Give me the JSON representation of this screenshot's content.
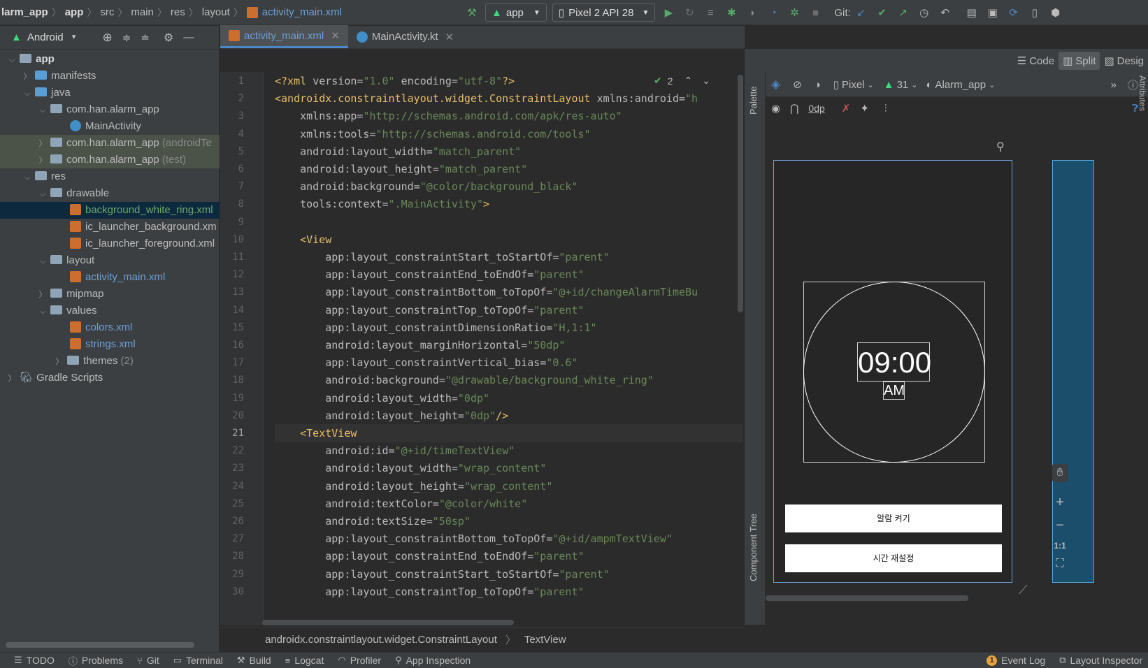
{
  "breadcrumb": [
    "larm_app",
    "app",
    "src",
    "main",
    "res",
    "layout",
    "activity_main.xml"
  ],
  "toolbar": {
    "run_config": "app",
    "device": "Pixel 2 API 28",
    "git_label": "Git:"
  },
  "project_panel": {
    "view_mode": "Android",
    "tree": [
      {
        "label": "app",
        "bold": true
      },
      {
        "label": "manifests"
      },
      {
        "label": "java"
      },
      {
        "label": "com.han.alarm_app"
      },
      {
        "label": "MainActivity"
      },
      {
        "label": "com.han.alarm_app",
        "suffix": "(androidTe"
      },
      {
        "label": "com.han.alarm_app",
        "suffix": "(test)"
      },
      {
        "label": "res"
      },
      {
        "label": "drawable"
      },
      {
        "label": "background_white_ring.xml"
      },
      {
        "label": "ic_launcher_background.xm"
      },
      {
        "label": "ic_launcher_foreground.xml"
      },
      {
        "label": "layout"
      },
      {
        "label": "activity_main.xml"
      },
      {
        "label": "mipmap"
      },
      {
        "label": "values"
      },
      {
        "label": "colors.xml"
      },
      {
        "label": "strings.xml"
      },
      {
        "label": "themes",
        "suffix": "(2)"
      },
      {
        "label": "Gradle Scripts"
      }
    ]
  },
  "editor_tabs": [
    "activity_main.xml",
    "MainActivity.kt"
  ],
  "inspection": {
    "count": "2"
  },
  "code_lines": [
    {
      "n": "1",
      "text": "<?xml version=\"1.0\" encoding=\"utf-8\"?>"
    },
    {
      "n": "2",
      "text": "<androidx.constraintlayout.widget.ConstraintLayout xmlns:android=\"h"
    },
    {
      "n": "3",
      "text": "    xmlns:app=\"http://schemas.android.com/apk/res-auto\""
    },
    {
      "n": "4",
      "text": "    xmlns:tools=\"http://schemas.android.com/tools\""
    },
    {
      "n": "5",
      "text": "    android:layout_width=\"match_parent\""
    },
    {
      "n": "6",
      "text": "    android:layout_height=\"match_parent\""
    },
    {
      "n": "7",
      "text": "    android:background=\"@color/background_black\""
    },
    {
      "n": "8",
      "text": "    tools:context=\".MainActivity\">"
    },
    {
      "n": "9",
      "text": ""
    },
    {
      "n": "10",
      "text": "    <View"
    },
    {
      "n": "11",
      "text": "        app:layout_constraintStart_toStartOf=\"parent\""
    },
    {
      "n": "12",
      "text": "        app:layout_constraintEnd_toEndOf=\"parent\""
    },
    {
      "n": "13",
      "text": "        app:layout_constraintBottom_toTopOf=\"@+id/changeAlarmTimeBu"
    },
    {
      "n": "14",
      "text": "        app:layout_constraintTop_toTopOf=\"parent\""
    },
    {
      "n": "15",
      "text": "        app:layout_constraintDimensionRatio=\"H,1:1\""
    },
    {
      "n": "16",
      "text": "        android:layout_marginHorizontal=\"50dp\""
    },
    {
      "n": "17",
      "text": "        app:layout_constraintVertical_bias=\"0.6\""
    },
    {
      "n": "18",
      "text": "        android:background=\"@drawable/background_white_ring\""
    },
    {
      "n": "19",
      "text": "        android:layout_width=\"0dp\""
    },
    {
      "n": "20",
      "text": "        android:layout_height=\"0dp\"/>"
    },
    {
      "n": "21",
      "text": "    <TextView"
    },
    {
      "n": "22",
      "text": "        android:id=\"@+id/timeTextView\""
    },
    {
      "n": "23",
      "text": "        android:layout_width=\"wrap_content\""
    },
    {
      "n": "24",
      "text": "        android:layout_height=\"wrap_content\""
    },
    {
      "n": "25",
      "text": "        android:textColor=\"@color/white\""
    },
    {
      "n": "26",
      "text": "        android:textSize=\"50sp\""
    },
    {
      "n": "27",
      "text": "        app:layout_constraintBottom_toTopOf=\"@+id/ampmTextView\""
    },
    {
      "n": "28",
      "text": "        app:layout_constraintEnd_toEndOf=\"parent\""
    },
    {
      "n": "29",
      "text": "        app:layout_constraintStart_toStartOf=\"parent\""
    },
    {
      "n": "30",
      "text": "        app:layout_constraintTop_toTopOf=\"parent\""
    }
  ],
  "view_modes": {
    "code": "Code",
    "split": "Split",
    "design": "Desig"
  },
  "design_toolbar": {
    "device": "Pixel",
    "api": "31",
    "theme": "Alarm_app",
    "margin": "0dp"
  },
  "side_tabs": {
    "palette": "Palette",
    "component_tree": "Component Tree",
    "attributes": "Attributes"
  },
  "preview": {
    "time": "09:00",
    "ampm": "AM",
    "button1": "알람 켜기",
    "button2": "시간 재설정"
  },
  "zoom_labels": {
    "one_to_one": "1:1"
  },
  "editor_breadcrumb": [
    "androidx.constraintlayout.widget.ConstraintLayout",
    "TextView"
  ],
  "status_bar": {
    "left": [
      "TODO",
      "Problems",
      "Git",
      "Terminal",
      "Build",
      "Logcat",
      "Profiler",
      "App Inspection"
    ],
    "right": [
      "Event Log",
      "Layout Inspector"
    ],
    "event_count": "1"
  }
}
